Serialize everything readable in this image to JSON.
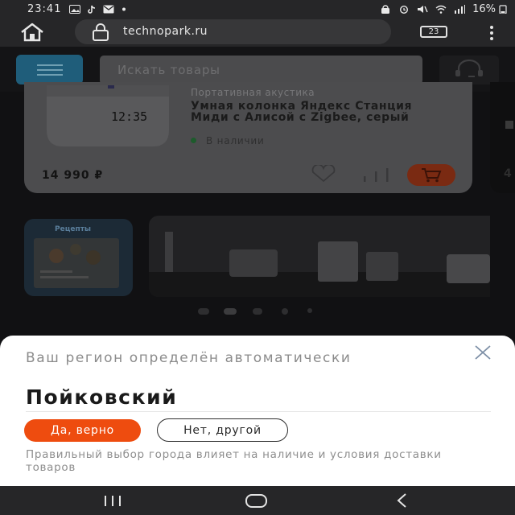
{
  "status_bar": {
    "time": "23:41",
    "battery": "16%",
    "left_icons": [
      "gallery-icon",
      "tiktok-icon",
      "mail-icon",
      "dot-icon"
    ],
    "right_icons": [
      "vpn-icon",
      "alarm-icon",
      "no-sound-icon",
      "wifi-icon",
      "signal-icon",
      "battery-icon"
    ]
  },
  "browser": {
    "url": "technopark.ru",
    "tab_count": "23"
  },
  "site": {
    "search_placeholder": "Искать товары",
    "product": {
      "category": "Портативная акустика",
      "name": "Умная колонка Яндекс Станция Миди с Алисой с Zigbee, серый",
      "availability": "В наличии",
      "price": "14 990 ₽",
      "display_time": "12:35"
    },
    "next_card_price_fragment": "4",
    "banner_left_title": "Рецепты",
    "carousel": {
      "dots": 5,
      "active_dot": 2
    }
  },
  "region_sheet": {
    "title": "Ваш регион определён автоматически",
    "city": "Пойковский",
    "confirm_label": "Да, верно",
    "other_label": "Нет, другой",
    "note": "Правильный выбор города влияет на наличие и условия доставки товаров"
  },
  "colors": {
    "accent": "#ee4c0f",
    "sheet_bg": "#ffffff",
    "system_bar": "#262628"
  }
}
